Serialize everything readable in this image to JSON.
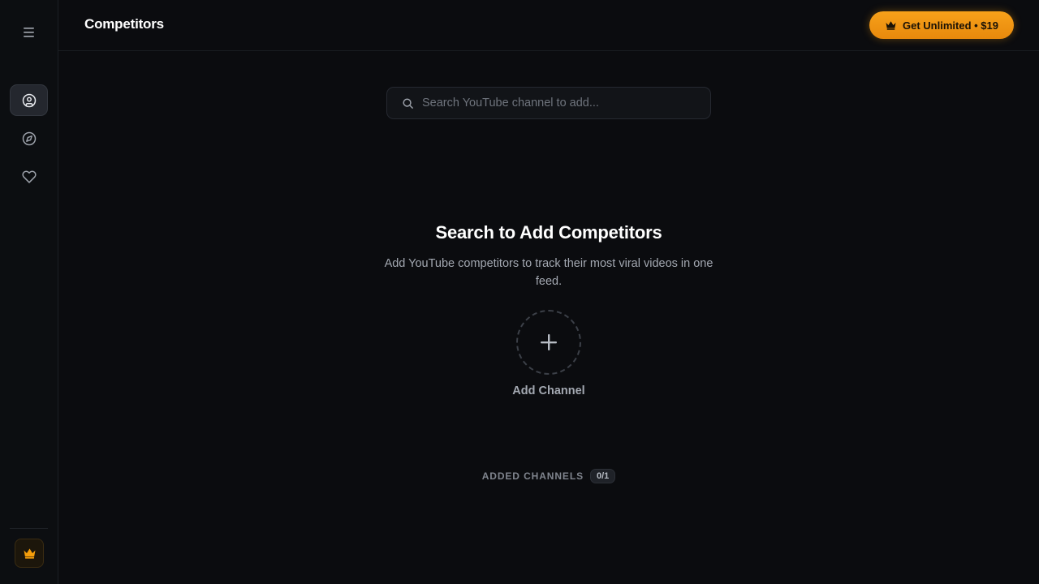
{
  "sidebar": {
    "items": [
      {
        "icon": "user-circle-icon",
        "active": true
      },
      {
        "icon": "compass-icon",
        "active": false
      },
      {
        "icon": "heart-icon",
        "active": false
      }
    ],
    "premium_icon": "crown-icon"
  },
  "header": {
    "title": "Competitors",
    "upgrade_label": "Get Unlimited • $19",
    "upgrade_icon": "crown-icon"
  },
  "search": {
    "placeholder": "Search YouTube channel to add...",
    "value": ""
  },
  "empty_state": {
    "title": "Search to Add Competitors",
    "description": "Add YouTube competitors to track their most viral videos in one feed.",
    "add_label": "Add Channel"
  },
  "added": {
    "label": "ADDED CHANNELS",
    "count": "0/1"
  },
  "colors": {
    "background": "#0b0c0f",
    "accent": "#f59e0b",
    "muted_text": "#a3a8b1"
  }
}
